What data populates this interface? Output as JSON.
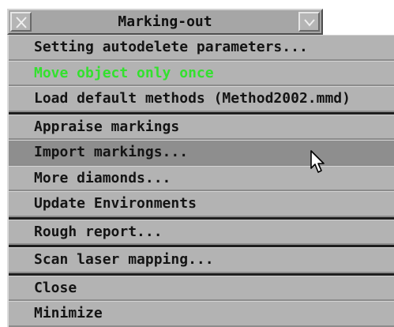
{
  "window": {
    "title": "Marking-out"
  },
  "menu": {
    "items": [
      {
        "label": "Setting autodelete parameters...",
        "highlight": false,
        "hover": false
      },
      {
        "label": "Move object only once",
        "highlight": true,
        "hover": false
      },
      {
        "label": "Load default methods (Method2002.mmd)",
        "highlight": false,
        "hover": false
      },
      {
        "label": "Appraise markings",
        "highlight": false,
        "hover": false
      },
      {
        "label": "Import markings...",
        "highlight": false,
        "hover": true
      },
      {
        "label": "More diamonds...",
        "highlight": false,
        "hover": false
      },
      {
        "label": "Update Environments",
        "highlight": false,
        "hover": false
      },
      {
        "label": "Rough report...",
        "highlight": false,
        "hover": false
      },
      {
        "label": "Scan laser mapping...",
        "highlight": false,
        "hover": false
      },
      {
        "label": "Close",
        "highlight": false,
        "hover": false
      },
      {
        "label": "Minimize",
        "highlight": false,
        "hover": false
      }
    ]
  },
  "colors": {
    "highlight_text": "#33e12e",
    "panel": "#b3b3b3",
    "hover": "#8e8e8e"
  },
  "icons": {
    "close": "close-icon",
    "menu": "chevron-down-icon",
    "cursor": "mouse-pointer-icon"
  }
}
